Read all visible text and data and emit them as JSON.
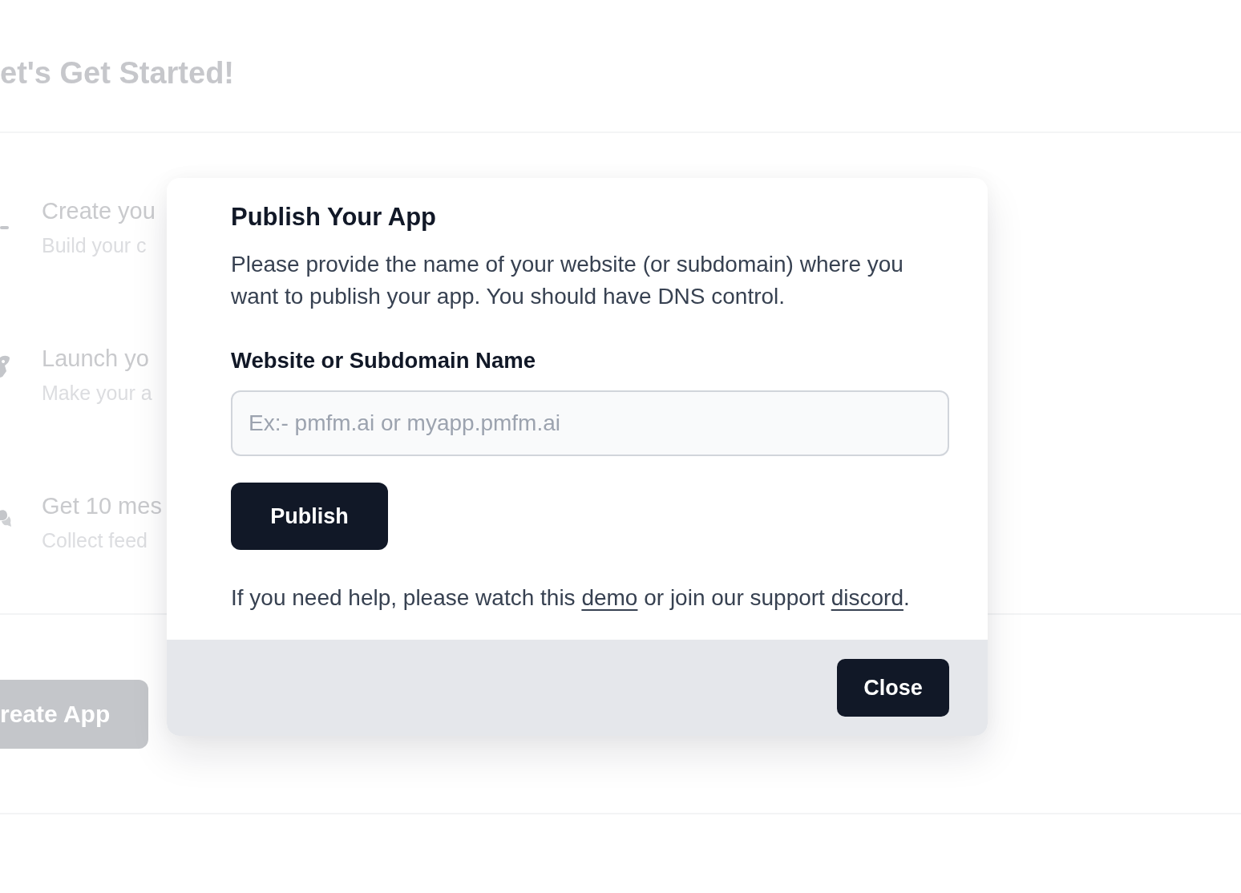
{
  "page": {
    "heading": "et's Get Started!",
    "steps": [
      {
        "title": "Create you",
        "subtitle": "Build your c"
      },
      {
        "title": "Launch yo",
        "subtitle": "Make your a"
      },
      {
        "title": "Get 10 mes",
        "subtitle": "Collect feed"
      }
    ],
    "create_button": "reate App"
  },
  "dialog": {
    "title": "Publish Your App",
    "description": "Please provide the name of your website (or subdomain) where you want to publish your app. You should have DNS control.",
    "field": {
      "label": "Website or Subdomain Name",
      "placeholder": "Ex:- pmfm.ai or myapp.pmfm.ai"
    },
    "publish_button": "Publish",
    "help": [
      {
        "kind": "text",
        "text": "If you need help, please watch this "
      },
      {
        "kind": "link",
        "text": "demo"
      },
      {
        "kind": "text",
        "text": " or join our support "
      },
      {
        "kind": "link",
        "text": "discord"
      },
      {
        "kind": "text",
        "text": "."
      }
    ],
    "close_button": "Close"
  }
}
